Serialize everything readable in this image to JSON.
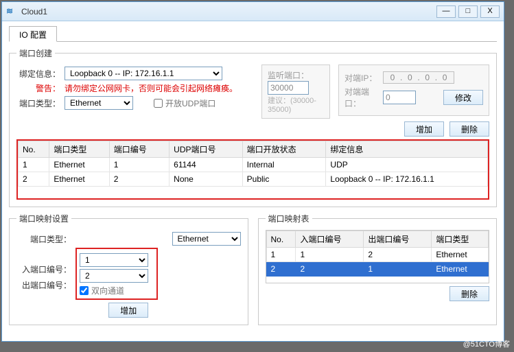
{
  "window": {
    "title": "Cloud1",
    "min": "—",
    "max": "□",
    "close": "X"
  },
  "tab": "IO 配置",
  "port_create": {
    "legend": "端口创建",
    "bind_label": "绑定信息：",
    "bind_value": "Loopback 0 -- IP: 172.16.1.1",
    "warn_label": "警告：",
    "warn_text": "请勿绑定公网网卡，否则可能会引起网络瘫痪。",
    "type_label": "端口类型：",
    "type_value": "Ethernet",
    "open_udp": "开放UDP端口",
    "listen_label": "监听端口：",
    "listen_value": "30000",
    "listen_hint": "建议：(30000-35000)",
    "peer_ip_label": "对端IP：",
    "peer_ip": [
      "0",
      "0",
      "0",
      "0"
    ],
    "peer_port_label": "对端端口：",
    "peer_port_value": "0",
    "modify": "修改",
    "add": "增加",
    "del": "删除",
    "cols": {
      "no": "No.",
      "ptype": "端口类型",
      "pno": "端口编号",
      "udp": "UDP端口号",
      "open": "端口开放状态",
      "bind": "绑定信息"
    },
    "rows": [
      {
        "no": "1",
        "ptype": "Ethernet",
        "pno": "1",
        "udp": "61144",
        "open": "Internal",
        "bind": "UDP"
      },
      {
        "no": "2",
        "ptype": "Ethernet",
        "pno": "2",
        "udp": "None",
        "open": "Public",
        "bind": "Loopback 0 -- IP: 172.16.1.1"
      }
    ]
  },
  "map_settings": {
    "legend": "端口映射设置",
    "type_label": "端口类型：",
    "type_value": "Ethernet",
    "in_label": "入端口编号：",
    "in_value": "1",
    "out_label": "出端口编号：",
    "out_value": "2",
    "bidir": "双向通道",
    "add": "增加"
  },
  "map_table": {
    "legend": "端口映射表",
    "cols": {
      "no": "No.",
      "in": "入端口编号",
      "out": "出端口编号",
      "ptype": "端口类型"
    },
    "rows": [
      {
        "no": "1",
        "in": "1",
        "out": "2",
        "ptype": "Ethernet",
        "sel": false
      },
      {
        "no": "2",
        "in": "2",
        "out": "1",
        "ptype": "Ethernet",
        "sel": true
      }
    ],
    "del": "删除"
  },
  "watermark": "@51CTO博客"
}
